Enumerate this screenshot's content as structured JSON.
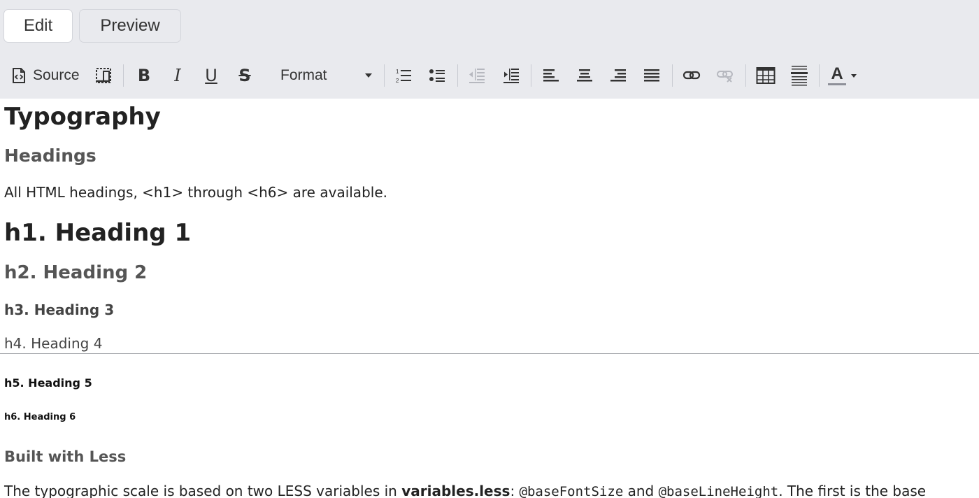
{
  "tabs": [
    {
      "label": "Edit",
      "active": true
    },
    {
      "label": "Preview",
      "active": false
    }
  ],
  "toolbar": {
    "source_label": "Source",
    "bold_label": "B",
    "italic_label": "I",
    "underline_label": "U",
    "strike_label": "S",
    "format_label": "Format",
    "text_color_label": "A",
    "icons": [
      "source-icon",
      "maximize-icon",
      "bold-icon",
      "italic-icon",
      "underline-icon",
      "strikethrough-icon",
      "chevron-down-icon",
      "numbered-list-icon",
      "bulleted-list-icon",
      "outdent-icon",
      "indent-icon",
      "align-left-icon",
      "align-center-icon",
      "align-right-icon",
      "align-justify-icon",
      "link-icon",
      "unlink-icon",
      "table-icon",
      "horizontal-rule-icon",
      "text-color-icon"
    ]
  },
  "content": {
    "title": "Typography",
    "subtitle": "Headings",
    "intro": "All HTML headings, <h1> through <h6> are available.",
    "h1": "h1. Heading 1",
    "h2": "h2. Heading 2",
    "h3": "h3. Heading 3",
    "h4": "h4. Heading 4",
    "h5": "h5. Heading 5",
    "h6": "h6. Heading 6",
    "built_heading": "Built with Less",
    "scale_prefix": "The typographic scale is based on two LESS variables in ",
    "scale_file": "variables.less",
    "scale_colon": ": ",
    "scale_var1": "@baseFontSize",
    "scale_and": " and ",
    "scale_var2": "@baseLineHeight",
    "scale_suffix": ". The first is the base"
  },
  "colors": {
    "toolbar_bg": "#e9eaee",
    "disabled_icon": "#b6b8bf",
    "text_color_underline": "#8e9099"
  }
}
